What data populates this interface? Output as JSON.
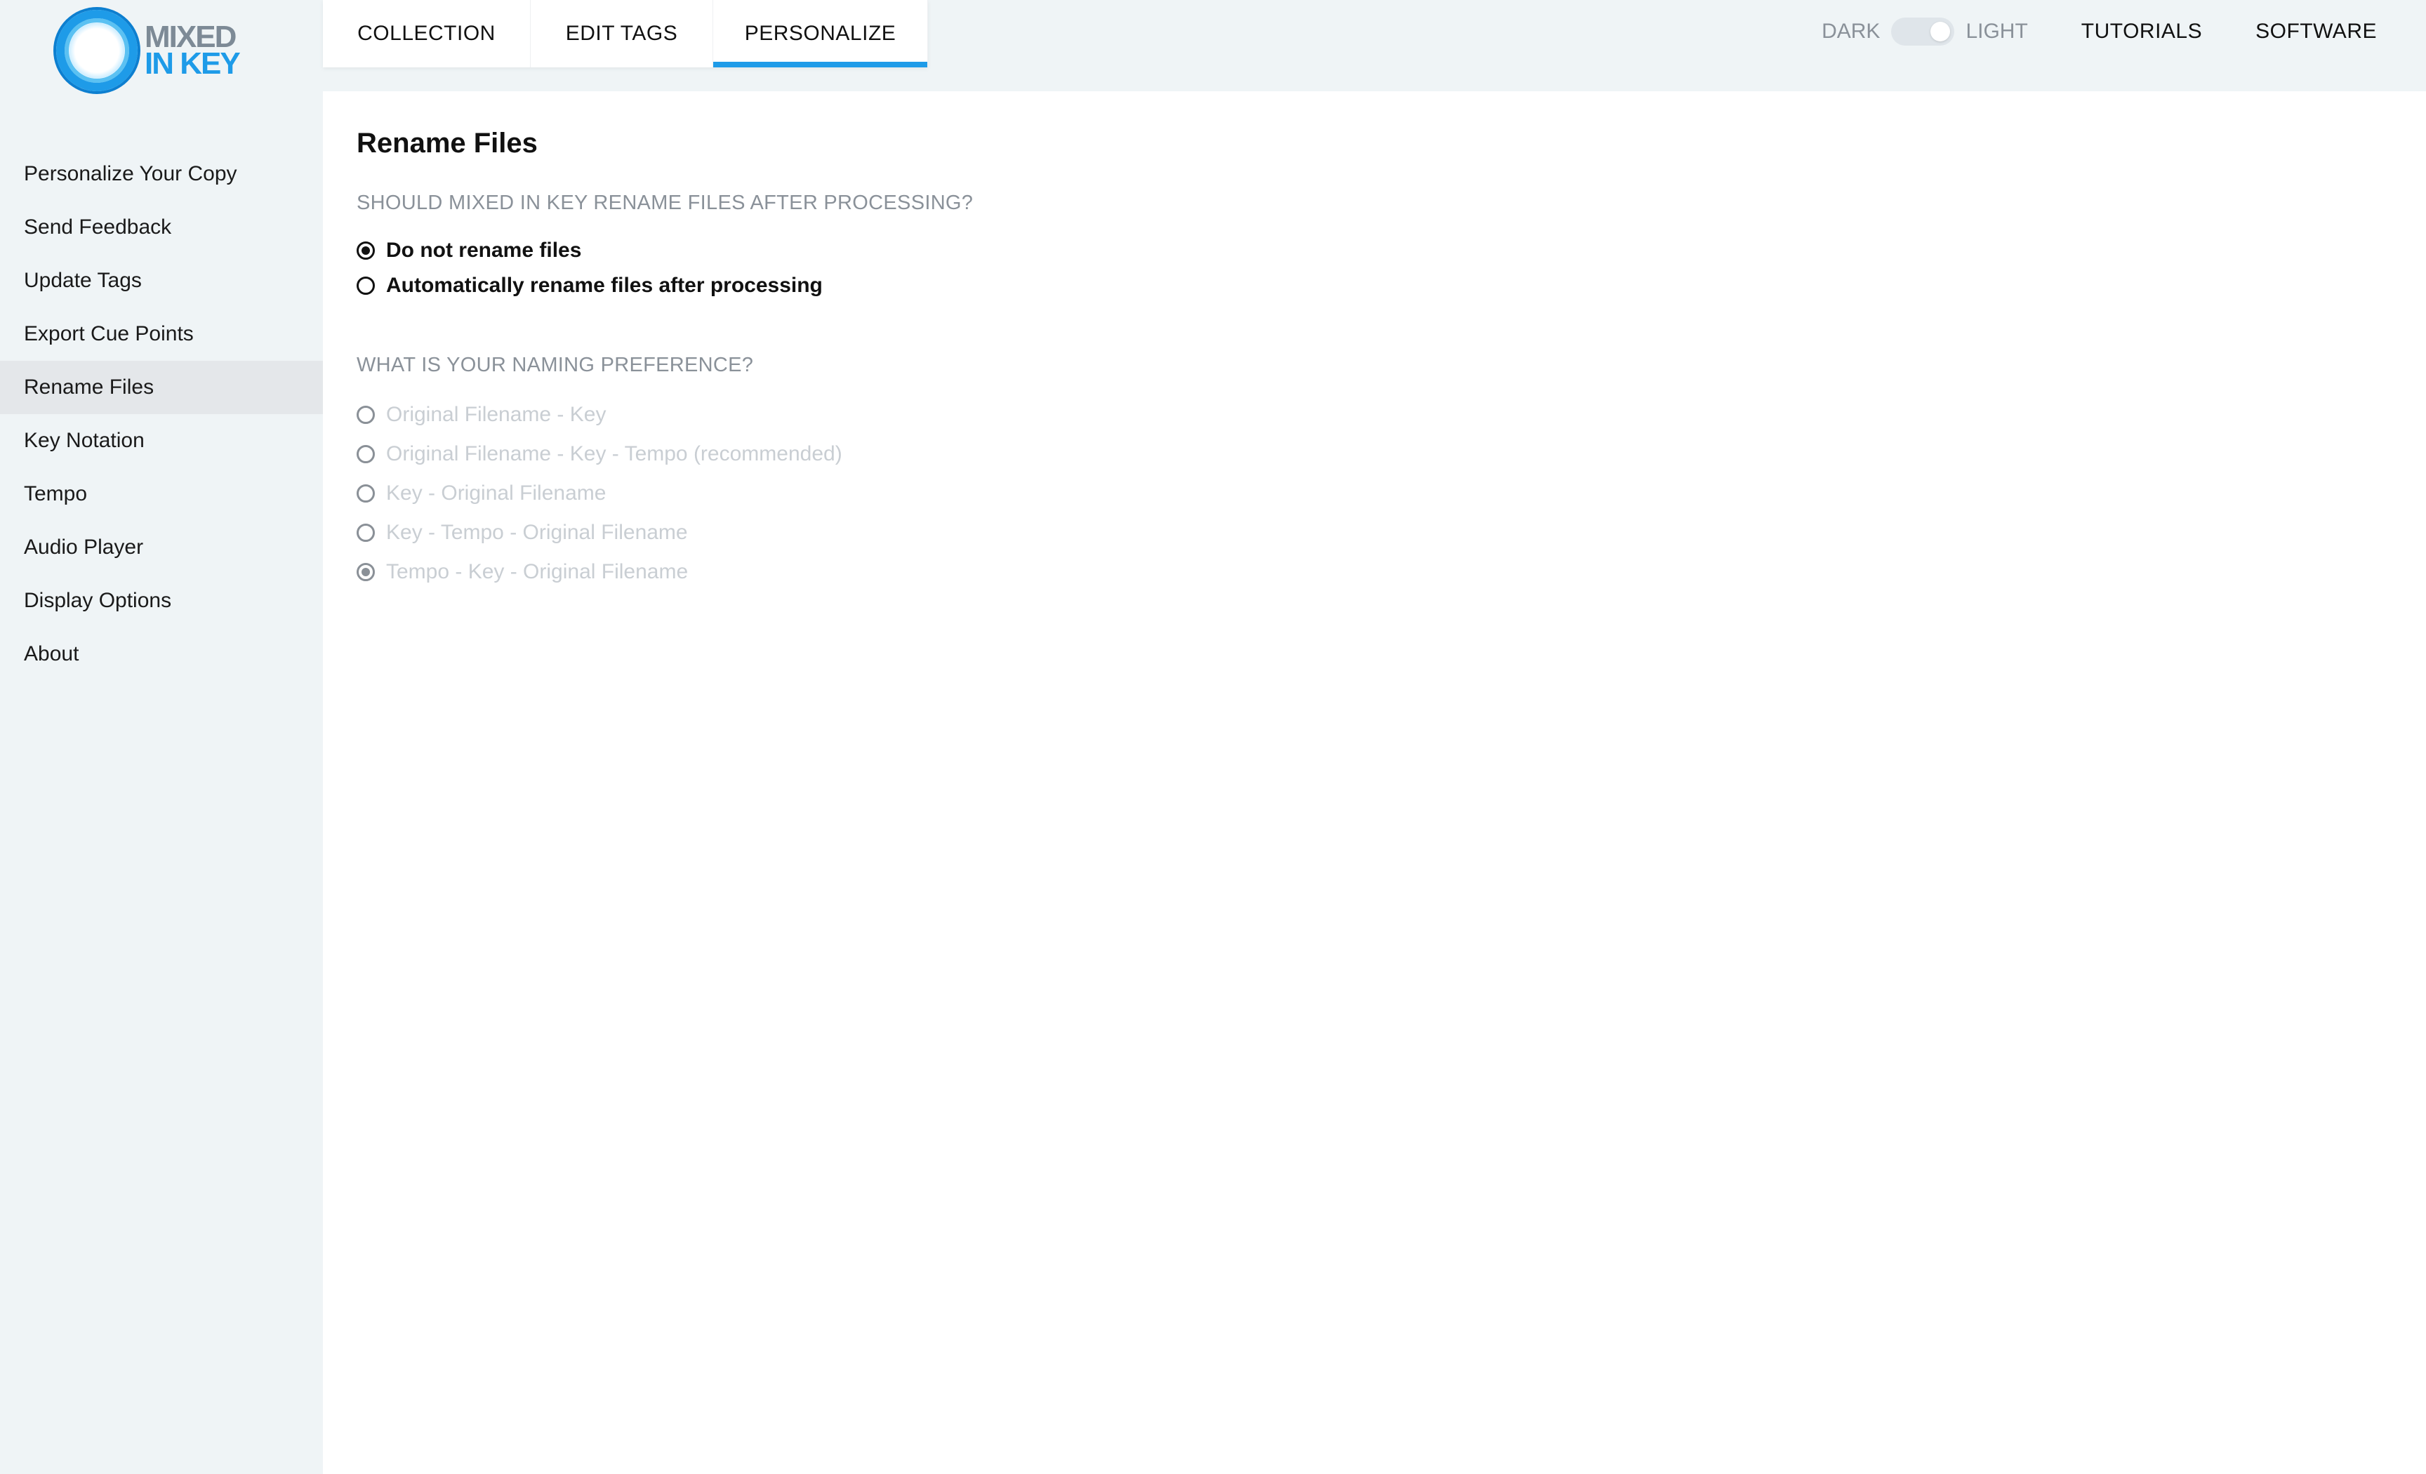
{
  "brand": {
    "logo_line1": "MIXED",
    "logo_line2": "IN KEY"
  },
  "sidebar": {
    "items": [
      {
        "label": "Personalize Your Copy"
      },
      {
        "label": "Send Feedback"
      },
      {
        "label": "Update Tags"
      },
      {
        "label": "Export Cue Points"
      },
      {
        "label": "Rename Files",
        "active": true
      },
      {
        "label": "Key Notation"
      },
      {
        "label": "Tempo"
      },
      {
        "label": "Audio Player"
      },
      {
        "label": "Display Options"
      },
      {
        "label": "About"
      }
    ]
  },
  "tabs": [
    {
      "label": "COLLECTION"
    },
    {
      "label": "EDIT TAGS"
    },
    {
      "label": "PERSONALIZE",
      "active": true
    }
  ],
  "topbar": {
    "dark_label": "DARK",
    "light_label": "LIGHT",
    "tutorials": "TUTORIALS",
    "software": "SOFTWARE"
  },
  "main": {
    "title": "Rename Files",
    "rename_question": "SHOULD MIXED IN KEY RENAME FILES AFTER PROCESSING?",
    "rename_options": [
      {
        "label": "Do not rename files",
        "checked": true
      },
      {
        "label": "Automatically rename files after processing",
        "checked": false
      }
    ],
    "naming_question": "WHAT IS YOUR NAMING PREFERENCE?",
    "naming_options": [
      {
        "label": "Original Filename - Key",
        "checked": false
      },
      {
        "label": "Original Filename - Key - Tempo (recommended)",
        "checked": false
      },
      {
        "label": "Key - Original Filename",
        "checked": false
      },
      {
        "label": "Key - Tempo - Original Filename",
        "checked": false
      },
      {
        "label": "Tempo - Key - Original Filename",
        "checked": true
      }
    ]
  },
  "colors": {
    "accent": "#1e9be8",
    "sidebar_bg": "#eff4f6",
    "active_item_bg": "#e4e7ea"
  }
}
